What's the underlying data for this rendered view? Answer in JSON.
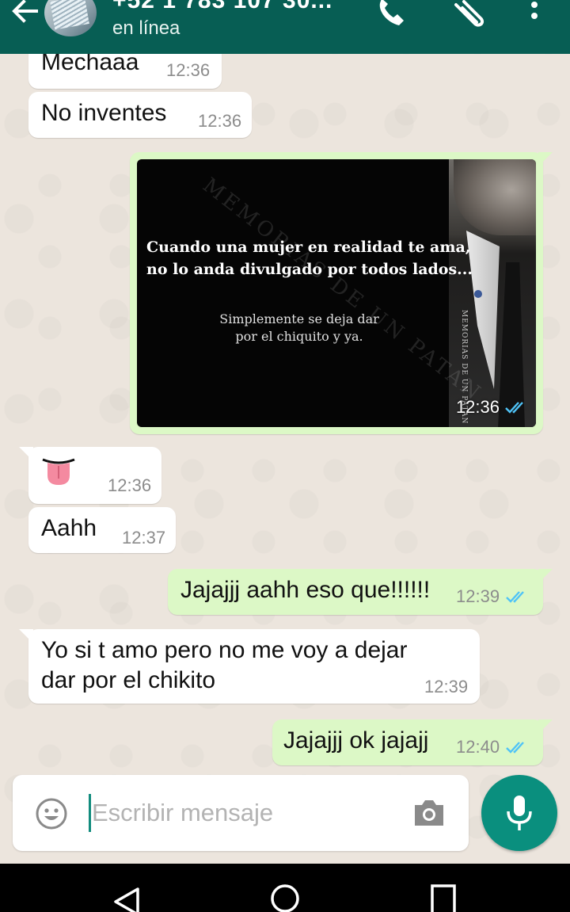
{
  "header": {
    "contact_name": "+52 1 783 107 30...",
    "status": "en línea"
  },
  "messages": [
    {
      "direction": "in",
      "text": "Mechaaa",
      "time": "12:36"
    },
    {
      "direction": "in",
      "text": "No inventes",
      "time": "12:36"
    },
    {
      "direction": "out",
      "type": "image",
      "time": "12:36",
      "image": {
        "line1": "Cuando una mujer en realidad te ama,",
        "line2": "no lo anda divulgado por todos lados...",
        "line3": "Simplemente se deja dar",
        "line4": "por el chiquito y ya.",
        "watermark": "MEMORIAS DE UN PATAN",
        "side_text": "MEMORIAS DE UN PATAN"
      }
    },
    {
      "direction": "in",
      "type": "sticker",
      "sticker": "tongue-emoji",
      "time": "12:36"
    },
    {
      "direction": "in",
      "text": "Aahh",
      "time": "12:37"
    },
    {
      "direction": "out",
      "text": "Jajajjj aahh eso que!!!!!!",
      "time": "12:39"
    },
    {
      "direction": "in",
      "text_line1": "Yo si t amo pero no me voy a dejar",
      "text_line2": "dar por el chikito",
      "time": "12:39"
    },
    {
      "direction": "out",
      "text": "Jajajjj ok jajajj",
      "time": "12:40"
    }
  ],
  "composer": {
    "placeholder": "Escribir mensaje"
  },
  "colors": {
    "header": "#075e54",
    "outgoing_bubble": "#dcf8c6",
    "incoming_bubble": "#ffffff",
    "read_ticks": "#4fc3f7",
    "mic_button": "#0a8f7e"
  },
  "icons": {
    "back": "back-arrow-icon",
    "call": "phone-icon",
    "attach": "paperclip-icon",
    "menu": "more-vert-icon",
    "emoji": "emoji-icon",
    "camera": "camera-icon",
    "mic": "mic-icon"
  }
}
